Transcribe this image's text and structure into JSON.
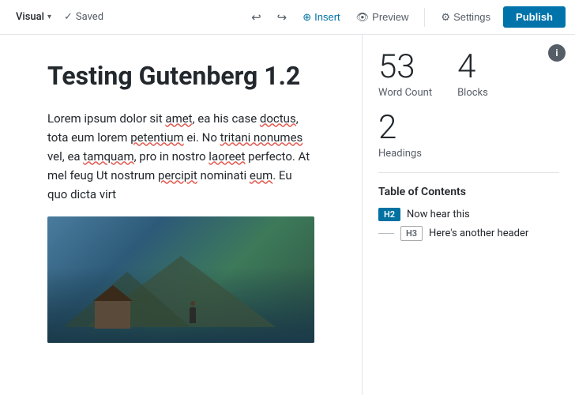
{
  "toolbar": {
    "view_label": "Visual",
    "saved_label": "Saved",
    "undo_title": "Undo",
    "redo_title": "Redo",
    "insert_label": "Insert",
    "preview_label": "Preview",
    "settings_label": "Settings",
    "publish_label": "Publish"
  },
  "editor": {
    "post_title": "Testing Gutenberg 1.2",
    "paragraph": "Lorem ipsum dolor sit amet, ea his case doctus, tota eum lorem petentium ei. No tritani nonumes vel, ea tamquam, pro in nostro laoreet perfecto. At mel feug Ut nostrum percipit nominati eum. Eu quo dicta virt"
  },
  "info_panel": {
    "info_icon": "i",
    "word_count_number": "53",
    "word_count_label": "Word Count",
    "blocks_number": "4",
    "blocks_label": "Blocks",
    "headings_number": "2",
    "headings_label": "Headings",
    "toc_title": "Table of Contents",
    "toc_items": [
      {
        "tag": "H2",
        "text": "Now hear this",
        "active": true
      },
      {
        "tag": "H3",
        "text": "Here's another header",
        "active": false
      }
    ]
  }
}
